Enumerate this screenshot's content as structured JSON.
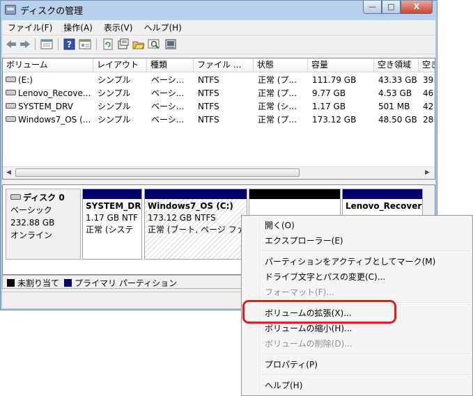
{
  "window": {
    "title": "ディスクの管理",
    "caption_buttons": [
      "—",
      "□",
      "X"
    ]
  },
  "menu": [
    "ファイル(F)",
    "操作(A)",
    "表示(V)",
    "ヘルプ(H)"
  ],
  "toolbar_icons": [
    "back-arrow-icon",
    "forward-arrow-icon",
    "show-list-icon",
    "help-icon",
    "properties-icon",
    "refresh-icon",
    "rescan-icon",
    "open-icon",
    "search-icon",
    "console-icon"
  ],
  "volume_table": {
    "headers": [
      "ボリューム",
      "レイアウト",
      "種類",
      "ファイル ...",
      "状態",
      "容量",
      "空き領域",
      "空き"
    ],
    "rows": [
      [
        "(E:)",
        "シンプル",
        "ベーシ...",
        "NTFS",
        "正常 (プ...",
        "111.79 GB",
        "43.33 GB",
        "39"
      ],
      [
        "Lenovo_Recove...",
        "シンプル",
        "ベーシ...",
        "NTFS",
        "正常 (プ...",
        "9.77 GB",
        "4.53 GB",
        "46"
      ],
      [
        "SYSTEM_DRV",
        "シンプル",
        "ベーシ...",
        "NTFS",
        "正常 (シ...",
        "1.17 GB",
        "501 MB",
        "42"
      ],
      [
        "Windows7_OS (...",
        "シンプル",
        "ベーシ...",
        "NTFS",
        "正常 (プ...",
        "173.12 GB",
        "48.50 GB",
        "28"
      ]
    ]
  },
  "disk": {
    "name": "ディスク 0",
    "type": "ベーシック",
    "size": "232.88 GB",
    "status": "オンライン"
  },
  "partitions": [
    {
      "name": "SYSTEM_DR",
      "line2": "1.17 GB NTF",
      "line3": "正常 (システ"
    },
    {
      "name": "Windows7_OS  (C:)",
      "line2": "173.12 GB NTFS",
      "line3": "正常 (ブート, ページ ファ"
    },
    {
      "name": "",
      "line2": "",
      "line3": ""
    },
    {
      "name": "Lenovo_Recover",
      "line2": "",
      "line3": ""
    }
  ],
  "legend": [
    {
      "label": "未割り当て",
      "color": "#000000"
    },
    {
      "label": "プライマリ パーティション",
      "color": "#00006b"
    }
  ],
  "context_menu": {
    "items": [
      "開く(O)",
      "エクスプローラー(E)",
      "パーティションをアクティブとしてマーク(M)",
      "ドライブ文字とパスの変更(C)...",
      "フォーマット(F)...",
      "ボリュームの拡張(X)...",
      "ボリュームの縮小(H)...",
      "ボリュームの削除(D)...",
      "プロパティ(P)",
      "ヘルプ(H)"
    ],
    "disabled": [
      false,
      false,
      false,
      false,
      true,
      false,
      false,
      true,
      false,
      false
    ]
  },
  "colors": {
    "highlight": "#e01e1e",
    "primary_partition": "#00006b"
  }
}
